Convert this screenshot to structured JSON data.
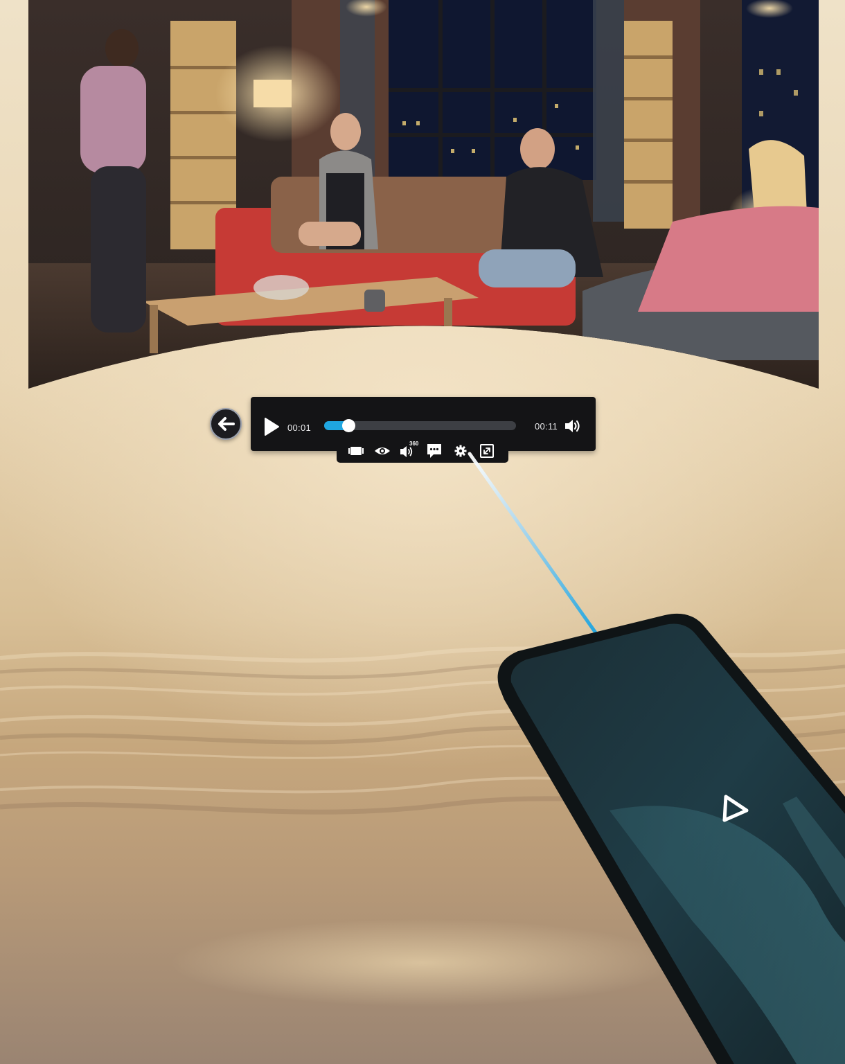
{
  "player": {
    "current_time": "00:01",
    "total_time": "00:11",
    "progress_percent": 13
  },
  "icons": {
    "back": "arrow-left-icon",
    "play": "play-icon",
    "volume": "speaker-volume-icon",
    "sub_bar": [
      "screen-mode-icon",
      "eye-view-icon",
      "spatial-audio-360-icon",
      "subtitles-icon",
      "settings-gear-icon",
      "fullscreen-icon"
    ],
    "phone_logo": "triangle-logo-icon"
  },
  "sub_bar": {
    "audio_badge": "360"
  },
  "colors": {
    "accent": "#1fa6e0",
    "bar_bg": "#141416",
    "track_bg": "#3d3f44"
  }
}
